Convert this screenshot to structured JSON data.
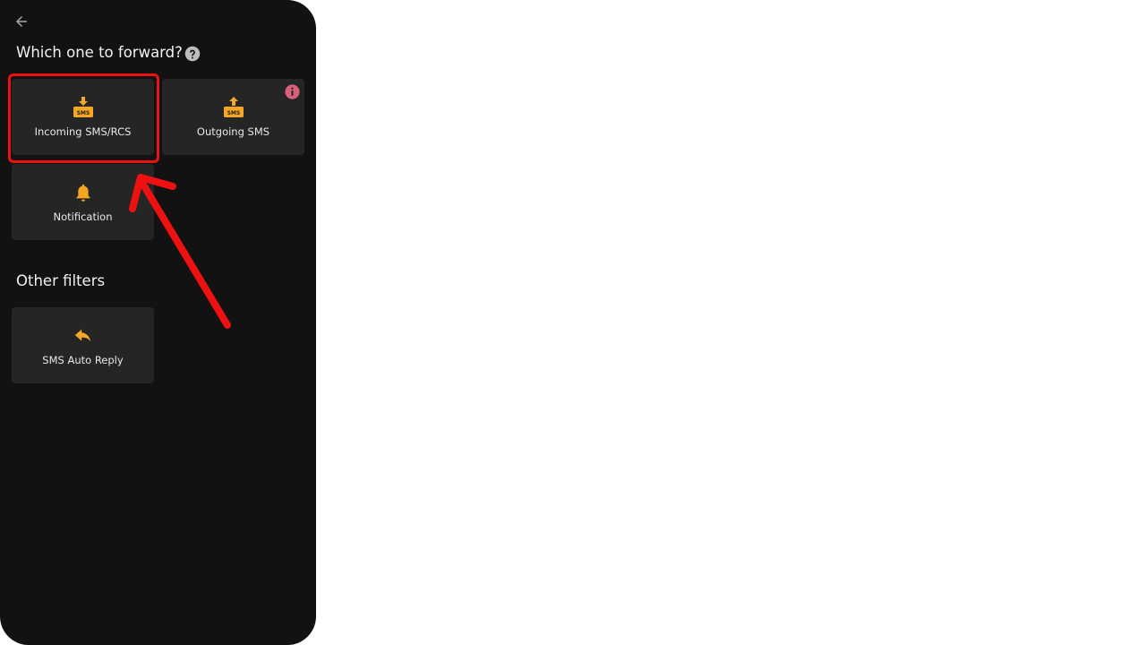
{
  "header": {
    "back_icon": "arrow-left-icon"
  },
  "forward_section": {
    "title": "Which one to forward?",
    "help_icon": "help-circle-icon",
    "options": [
      {
        "label": "Incoming SMS/RCS",
        "icon": "sms-incoming-icon"
      },
      {
        "label": "Outgoing SMS",
        "icon": "sms-outgoing-icon",
        "badge_icon": "info-icon"
      },
      {
        "label": "Notification",
        "icon": "bell-icon"
      }
    ]
  },
  "other_section": {
    "title": "Other filters",
    "options": [
      {
        "label": "SMS Auto Reply",
        "icon": "reply-icon"
      }
    ]
  },
  "sms_badge_text": "SMS",
  "colors": {
    "background": "#121212",
    "tile": "#252525",
    "accent": "#f5a623",
    "info_badge": "#d9607a",
    "annotation": "#ee1111"
  }
}
